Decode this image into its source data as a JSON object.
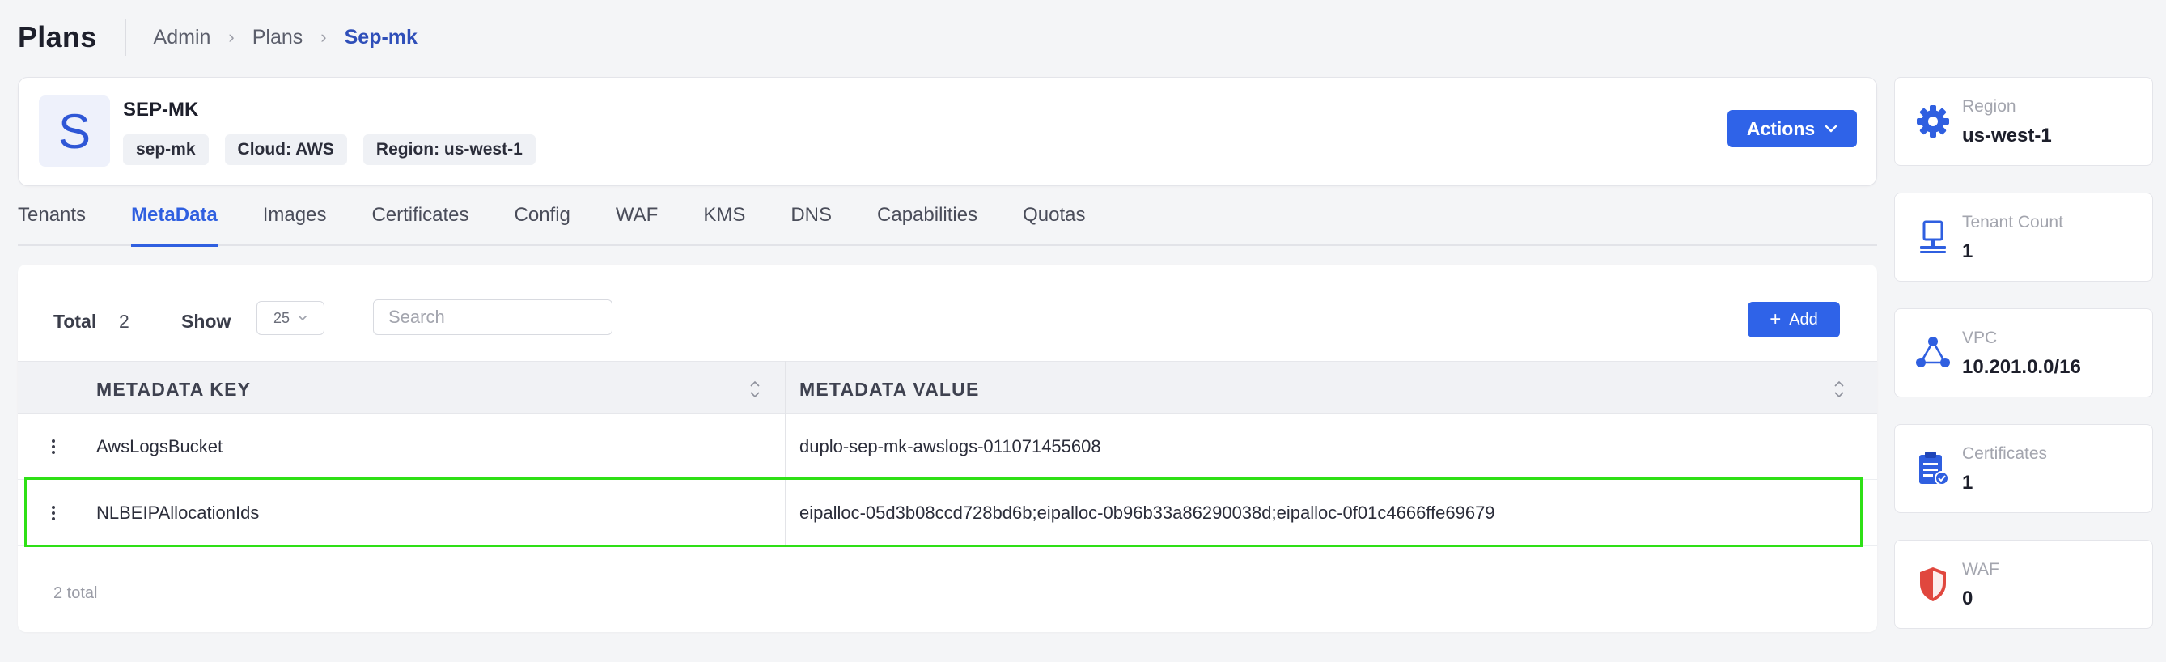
{
  "header": {
    "title": "Plans",
    "breadcrumb": [
      "Admin",
      "Plans",
      "Sep-mk"
    ]
  },
  "plan": {
    "avatar_letter": "S",
    "name": "SEP-MK",
    "tags": [
      "sep-mk",
      "Cloud: AWS",
      "Region: us-west-1"
    ],
    "actions_label": "Actions"
  },
  "tabs": [
    {
      "label": "Tenants",
      "active": false
    },
    {
      "label": "MetaData",
      "active": true
    },
    {
      "label": "Images",
      "active": false
    },
    {
      "label": "Certificates",
      "active": false
    },
    {
      "label": "Config",
      "active": false
    },
    {
      "label": "WAF",
      "active": false
    },
    {
      "label": "KMS",
      "active": false
    },
    {
      "label": "DNS",
      "active": false
    },
    {
      "label": "Capabilities",
      "active": false
    },
    {
      "label": "Quotas",
      "active": false
    }
  ],
  "toolbar": {
    "total_label": "Total",
    "total_value": "2",
    "show_label": "Show",
    "page_size": "25",
    "search_placeholder": "Search",
    "add_label": "Add"
  },
  "table": {
    "columns": [
      "METADATA KEY",
      "METADATA VALUE"
    ],
    "rows": [
      {
        "key": "AwsLogsBucket",
        "value": "duplo-sep-mk-awslogs-011071455608"
      },
      {
        "key": "NLBEIPAllocationIds",
        "value": "eipalloc-05d3b08ccd728bd6b;eipalloc-0b96b33a86290038d;eipalloc-0f01c4666ffe69679"
      }
    ],
    "footer": "2 total"
  },
  "stats": [
    {
      "label": "Region",
      "value": "us-west-1",
      "icon": "gear-icon"
    },
    {
      "label": "Tenant Count",
      "value": "1",
      "icon": "monitor-icon"
    },
    {
      "label": "VPC",
      "value": "10.201.0.0/16",
      "icon": "network-icon"
    },
    {
      "label": "Certificates",
      "value": "1",
      "icon": "clipboard-check-icon"
    },
    {
      "label": "WAF",
      "value": "0",
      "icon": "shield-icon"
    }
  ],
  "colors": {
    "primary": "#2f63e8",
    "active_tab": "#2f5fe0",
    "highlight": "#2ee016",
    "waf_icon": "#e0473e"
  }
}
